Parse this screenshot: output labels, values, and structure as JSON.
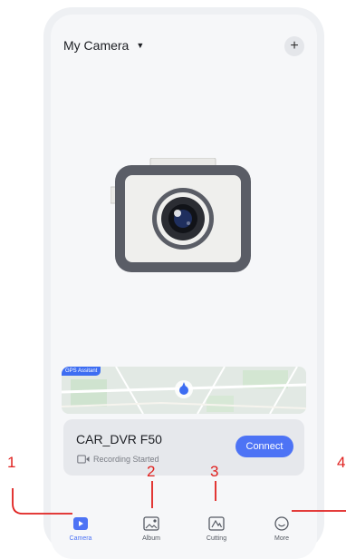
{
  "header": {
    "title": "My Camera",
    "caret": "▼",
    "add_label": "+"
  },
  "map": {
    "badge": "GPS Assitant"
  },
  "device": {
    "name": "CAR_DVR F50",
    "status": "Recording Started",
    "connect_label": "Connect"
  },
  "tabs": [
    {
      "label": "Camera",
      "icon": "video-camera-icon",
      "active": true
    },
    {
      "label": "Album",
      "icon": "photo-album-icon",
      "active": false
    },
    {
      "label": "Cutting",
      "icon": "mountain-cut-icon",
      "active": false
    },
    {
      "label": "More",
      "icon": "smile-circle-icon",
      "active": false
    }
  ],
  "annotations": [
    "1",
    "2",
    "3",
    "4"
  ],
  "colors": {
    "accent": "#4d73f5",
    "annotation": "#e0211f",
    "camera_body": "#5a5d66",
    "camera_face": "#efefed"
  }
}
